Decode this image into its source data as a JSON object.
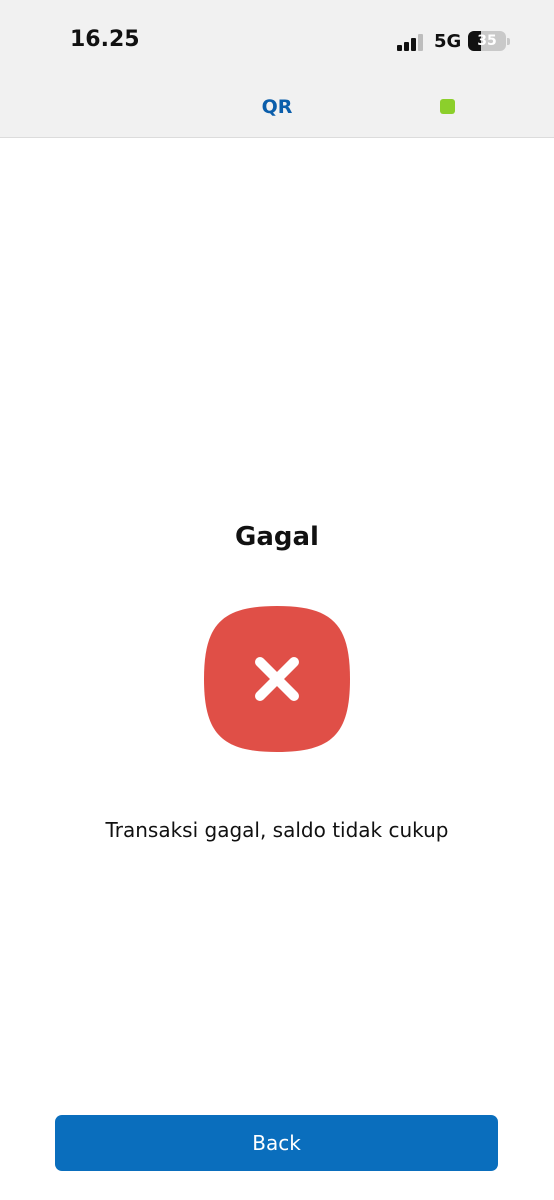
{
  "status_bar": {
    "time": "16.25",
    "network": "5G",
    "battery_level": "35",
    "signal_bars_filled": 3,
    "signal_bars_total": 4
  },
  "header": {
    "title": "QR",
    "status_indicator_color": "#8ccf2b",
    "title_color": "#0b5eab"
  },
  "result": {
    "title": "Gagal",
    "icon": "close-icon",
    "icon_color": "#e04f47",
    "message": "Transaksi gagal, saldo tidak cukup"
  },
  "actions": {
    "back_label": "Back",
    "back_color": "#0a6ebd"
  }
}
